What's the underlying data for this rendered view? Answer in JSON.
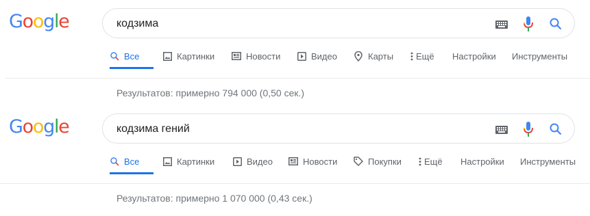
{
  "results": [
    {
      "logo": "Google",
      "query": "кодзима",
      "tabs": [
        "Все",
        "Картинки",
        "Новости",
        "Видео",
        "Карты",
        "Ещё",
        "Настройки",
        "Инструменты"
      ],
      "stats": "Результатов: примерно 794 000 (0,50 сек.)"
    },
    {
      "logo": "Google",
      "query": "кодзима гений",
      "tabs": [
        "Все",
        "Картинки",
        "Видео",
        "Новости",
        "Покупки",
        "Ещё",
        "Настройки",
        "Инструменты"
      ],
      "stats": "Результатов: примерно 1 070 000 (0,43 сек.)"
    }
  ],
  "icons": {
    "all": "search-icon",
    "images": "image-icon",
    "news": "newspaper-icon",
    "video": "play-icon",
    "maps": "map-pin-icon",
    "shopping": "tag-icon",
    "more": "more-vert-icon"
  },
  "colors": {
    "blue": "#4285f4",
    "red": "#ea4335",
    "yellow": "#fbbc05",
    "green": "#34a853",
    "accent": "#1a73e8",
    "text": "#202124",
    "muted": "#5f6368",
    "stats": "#70757a"
  }
}
